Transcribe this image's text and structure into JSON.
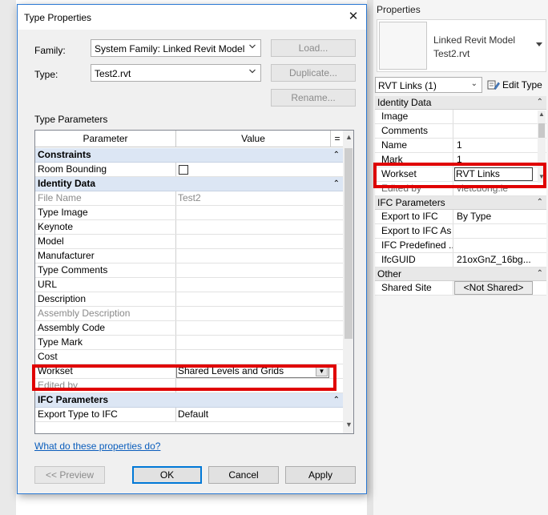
{
  "dialog": {
    "title": "Type Properties",
    "family_label": "Family:",
    "family_value": "System Family: Linked Revit Model",
    "type_label": "Type:",
    "type_value": "Test2.rvt",
    "load_button": "Load...",
    "duplicate_button": "Duplicate...",
    "rename_button": "Rename...",
    "type_parameters_label": "Type Parameters",
    "columns": {
      "parameter": "Parameter",
      "value": "Value",
      "eq": "="
    },
    "groups": [
      {
        "name": "Constraints",
        "rows": [
          {
            "param": "Room Bounding",
            "value": "",
            "checkbox": true,
            "disabled": false
          }
        ]
      },
      {
        "name": "Identity Data",
        "rows": [
          {
            "param": "File Name",
            "value": "Test2",
            "disabled": true
          },
          {
            "param": "Type Image",
            "value": ""
          },
          {
            "param": "Keynote",
            "value": ""
          },
          {
            "param": "Model",
            "value": ""
          },
          {
            "param": "Manufacturer",
            "value": ""
          },
          {
            "param": "Type Comments",
            "value": ""
          },
          {
            "param": "URL",
            "value": ""
          },
          {
            "param": "Description",
            "value": ""
          },
          {
            "param": "Assembly Description",
            "value": "",
            "disabled": true
          },
          {
            "param": "Assembly Code",
            "value": ""
          },
          {
            "param": "Type Mark",
            "value": ""
          },
          {
            "param": "Cost",
            "value": ""
          },
          {
            "param": "Workset",
            "value": "Shared Levels and Grids",
            "combo": true
          },
          {
            "param": "Edited by",
            "value": "",
            "disabled": true
          }
        ]
      },
      {
        "name": "IFC Parameters",
        "rows": [
          {
            "param": "Export Type to IFC",
            "value": "Default"
          }
        ]
      }
    ],
    "help_link": "What do these properties do?",
    "preview_button": "<< Preview",
    "ok_button": "OK",
    "cancel_button": "Cancel",
    "apply_button": "Apply"
  },
  "properties": {
    "title": "Properties",
    "type_name_line1": "Linked Revit Model",
    "type_name_line2": "Test2.rvt",
    "filter_value": "RVT Links (1)",
    "edit_type_label": "Edit Type",
    "groups": [
      {
        "name": "Identity Data",
        "rows": [
          {
            "param": "Image",
            "value": ""
          },
          {
            "param": "Comments",
            "value": ""
          },
          {
            "param": "Name",
            "value": "1"
          },
          {
            "param": "Mark",
            "value": "1"
          },
          {
            "param": "Workset",
            "value": "RVT Links",
            "input": true
          },
          {
            "param": "Edited by",
            "value": "vietcuong.le",
            "grey": true
          }
        ]
      },
      {
        "name": "IFC Parameters",
        "rows": [
          {
            "param": "Export to IFC",
            "value": "By Type"
          },
          {
            "param": "Export to IFC As",
            "value": ""
          },
          {
            "param": "IFC Predefined ...",
            "value": ""
          },
          {
            "param": "IfcGUID",
            "value": "21oxGnZ_16bg..."
          }
        ]
      },
      {
        "name": "Other",
        "rows": [
          {
            "param": "Shared Site",
            "value": "<Not Shared>",
            "button": true
          }
        ]
      }
    ]
  },
  "colors": {
    "highlight": "#e00000",
    "accent": "#0078d7",
    "link": "#0a5dbc",
    "group_header_bg": "#dce6f4"
  }
}
